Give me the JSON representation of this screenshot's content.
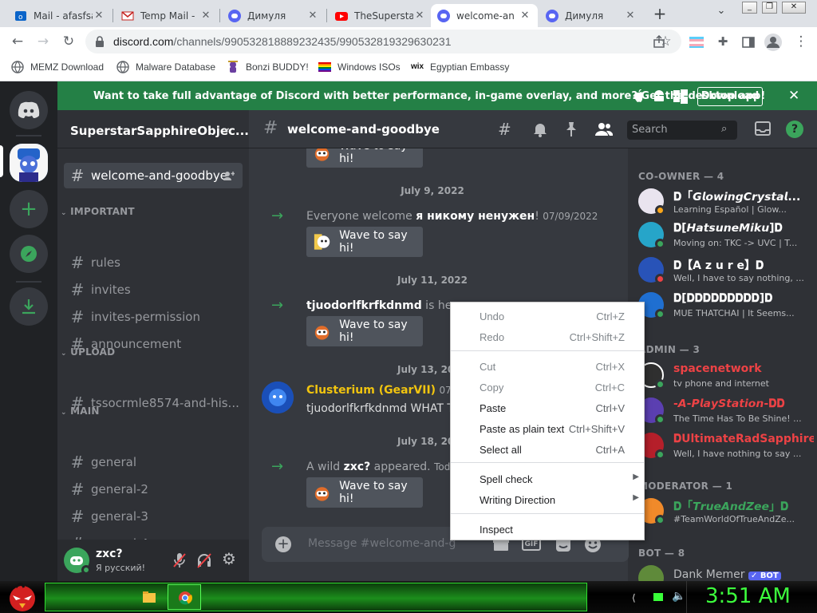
{
  "browser": {
    "tabs": [
      {
        "title": "Mail - afasfsa",
        "icon": "outlook-icon"
      },
      {
        "title": "Temp Mail -",
        "icon": "gmail-icon"
      },
      {
        "title": "Димуля",
        "icon": "discord-icon"
      },
      {
        "title": "TheSuperstar",
        "icon": "youtube-icon"
      },
      {
        "title": "welcome-an",
        "icon": "discord-icon",
        "active": true
      },
      {
        "title": "Димуля",
        "icon": "discord-icon"
      }
    ],
    "url_host": "discord.com",
    "url_path": "/channels/990532818889232435/990532819329630231",
    "bookmarks": [
      "MEMZ Download",
      "Malware Database",
      "Bonzi BUDDY!",
      "Windows ISOs",
      "Egyptian Embassy"
    ]
  },
  "banner": {
    "text": "Want to take full advantage of Discord with better performance, in-game overlay, and more? Get the desktop app!",
    "button": "Download"
  },
  "server": {
    "name": "SuperstarSapphireObjec...",
    "selected_channel": "welcome-and-goodbye",
    "categories": [
      {
        "label": "IMPORTANT",
        "channels": [
          "rules",
          "invites",
          "invites-permission",
          "announcement"
        ]
      },
      {
        "label": "UPLOAD",
        "channels": [
          "tssocrmle8574-and-his..."
        ]
      },
      {
        "label": "MAIN",
        "channels": [
          "general",
          "general-2",
          "general-3",
          "general-4"
        ]
      }
    ]
  },
  "user": {
    "name": "zxc?",
    "status": "Я русский!"
  },
  "chat": {
    "channel": "welcome-and-goodbye",
    "search_placeholder": "Search",
    "composer_placeholder": "Message #welcome-and-g",
    "wave_label": "Wave to say hi!",
    "days": [
      "July 9, 2022",
      "July 11, 2022",
      "July 13, 2022",
      "July 18, 2022"
    ],
    "join1": {
      "pre": "Everyone welcome ",
      "name": "я никому ненужен",
      "post": "!",
      "time": "07/09/2022"
    },
    "join2": {
      "name": "tjuodorlfkrfkdnmd",
      "post": " is here."
    },
    "message": {
      "author": "Clusterium (GearVII)",
      "time": "07/13/",
      "text": "tjuodorlfkrfkdnmd WHAT T"
    },
    "join3": {
      "pre": "A wild ",
      "name": "zxc?",
      "post": " appeared.",
      "time": "Today"
    }
  },
  "members": {
    "groups": [
      {
        "label": "CO-OWNER — 4",
        "items": [
          {
            "name": "𝐃「𝙂𝙡𝙤𝙬𝙞𝙣𝙜𝘾𝙧𝙮𝙨𝙩𝙖𝙡...",
            "status": "Learning Español | Glow...",
            "color": "#ffffff",
            "avatar": "#e9e4ef",
            "presence": "#faa61a"
          },
          {
            "name": "𝐃[𝙃𝙖𝙩𝙨𝙪𝙣𝙚𝙈𝙞𝙠𝙪]𝐃",
            "status": "Moving on: TKC -> UVC | T...",
            "color": "#ffffff",
            "avatar": "#26a5c9",
            "presence": "#3ba55c"
          },
          {
            "name": "𝐃【A z u r e】𝐃",
            "status": "Well, I have to say nothing, ...",
            "color": "#ffffff",
            "avatar": "#2853b8",
            "presence": "#ed4245"
          },
          {
            "name": "𝐃[𝐃𝐃𝐃𝐃𝐃𝐃𝐃𝐃𝐃]𝐃",
            "status": "MUE THATCHAI | It Seems...",
            "color": "#ffffff",
            "avatar": "#1f6fd1",
            "presence": "#3ba55c"
          }
        ]
      },
      {
        "label": "ADMIN — 3",
        "items": [
          {
            "name": "spacenetwork",
            "status": "tv phone and internet",
            "color": "#ed4245",
            "avatar": "#2f2f2f",
            "presence": "#3ba55c"
          },
          {
            "name": "-𝘼-𝙋𝙡𝙖𝙮𝙎𝙩𝙖𝙩𝙞𝙤𝙣-𝐃𝐃",
            "status": "The Time Has To Be Shine! ...",
            "color": "#ed4245",
            "avatar": "#5b3fb1",
            "presence": "#3ba55c"
          },
          {
            "name": "𝐃UltimateRadSapphire...",
            "status": "Well, I have nothing to say ...",
            "color": "#ed4245",
            "avatar": "#b51f2a",
            "presence": "#3ba55c"
          }
        ]
      },
      {
        "label": "MODERATOR — 1",
        "items": [
          {
            "name": "𝐃「𝙏𝙧𝙪𝙚𝘼𝙣𝙙𝙕𝙚𝙚」𝐃",
            "status": "#TeamWorldOfTrueAndZe...",
            "color": "#3ba55c",
            "avatar": "#f08a2a",
            "presence": "#3ba55c"
          }
        ]
      },
      {
        "label": "BOT — 8",
        "items": [
          {
            "name": "Dank Memer",
            "status": "",
            "color": "#b9bbbe",
            "avatar": "#5f8a3a",
            "presence": "#3ba55c",
            "badge": "✓ BOT"
          }
        ]
      }
    ]
  },
  "context_menu": {
    "items": [
      {
        "label": "Undo",
        "shortcut": "Ctrl+Z",
        "disabled": true
      },
      {
        "label": "Redo",
        "shortcut": "Ctrl+Shift+Z",
        "disabled": true
      },
      {
        "label": "Cut",
        "shortcut": "Ctrl+X",
        "disabled": true
      },
      {
        "label": "Copy",
        "shortcut": "Ctrl+C",
        "disabled": true
      },
      {
        "label": "Paste",
        "shortcut": "Ctrl+V",
        "disabled": false
      },
      {
        "label": "Paste as plain text",
        "shortcut": "Ctrl+Shift+V",
        "disabled": false
      },
      {
        "label": "Select all",
        "shortcut": "Ctrl+A",
        "disabled": false
      },
      {
        "label": "Spell check",
        "shortcut": "",
        "submenu": true
      },
      {
        "label": "Writing Direction",
        "shortcut": "",
        "submenu": true
      },
      {
        "label": "Inspect",
        "shortcut": ""
      }
    ]
  },
  "taskbar": {
    "clock": "3:51 AM"
  },
  "colors": {
    "discord_blurple": "#5865f2",
    "banner_green": "#248046",
    "clock_green": "#3dff3d"
  }
}
